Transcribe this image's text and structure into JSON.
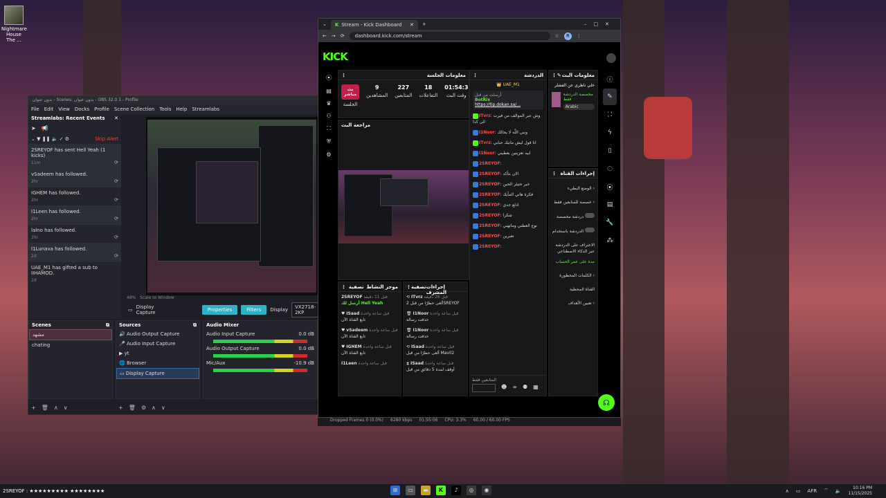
{
  "desktop": {
    "icon_label": "Nightmare House The ..."
  },
  "obs": {
    "title": "بدون عنوان - Scenes: بدون عنوان - OBS 32.0.1 - Profile",
    "menu": [
      "File",
      "Edit",
      "View",
      "Docks",
      "Profile",
      "Scene Collection",
      "Tools",
      "Help",
      "Streamlabs"
    ],
    "events_title": "Streamlabs: Recent Events",
    "skip_alert": "Skip Alert",
    "events": [
      {
        "text": "2SREYOF has sent Hell Yeah (1 kicks)",
        "time": "11m"
      },
      {
        "text": "vSadeem has followed.",
        "time": "2hr"
      },
      {
        "text": "IGHEM has followed.",
        "time": "2hr"
      },
      {
        "text": "I1Leen has followed.",
        "time": "2hr"
      },
      {
        "text": "lalno has followed.",
        "time": "2hr"
      },
      {
        "text": "I1Lunava has followed.",
        "time": "2d"
      },
      {
        "text": "UAE_M1 has gifted a sub to IIHAMOD.",
        "time": "2d"
      }
    ],
    "preview_bar": "Scale to Window",
    "preview_zoom": "48%",
    "context": {
      "source": "Display Capture",
      "properties": "Properties",
      "filters": "Filters",
      "display_label": "Display",
      "display_value": "VX2718-2KP"
    },
    "scenes_title": "Scenes",
    "scenes": [
      "مشهد",
      "chating"
    ],
    "sources_title": "Sources",
    "sources": [
      "Audio Output Capture",
      "Audio Input Capture",
      "yt",
      "Browser",
      "Display Capture"
    ],
    "mixer_title": "Audio Mixer",
    "mixer": [
      {
        "name": "Audio Input Capture",
        "level": "0.0 dB"
      },
      {
        "name": "Audio Output Capture",
        "level": "0.0 dB"
      },
      {
        "name": "Mic/Aux",
        "level": "-10.9 dB"
      }
    ]
  },
  "chrome": {
    "tab_title": "Stream - Kick Dashboard",
    "url": "dashboard.kick.com/stream",
    "avatar_letter": "R"
  },
  "kick": {
    "logo": "KICK",
    "session": {
      "title": "معلومات الجلسة",
      "live_badge": "بث مباشر",
      "live_label": "الجلسة",
      "stats": [
        {
          "value": "9",
          "label": "المشاهدين"
        },
        {
          "value": "227",
          "label": "المتابعين"
        },
        {
          "value": "18",
          "label": "التفاعلات"
        },
        {
          "value": "01:54:3",
          "label": "وقت البث"
        }
      ]
    },
    "preview_title": "مراجعة البث",
    "chat": {
      "title": "الدردشة",
      "pinned_user": "UAE_M1",
      "pinned_by": "BotRix",
      "pinned_sent_by": "أرسلت من قبل",
      "pinned_link": "https://tip.dokan.sa/...",
      "lines": [
        {
          "user": "ITvrz",
          "msg": "وش عبر الموالف من فيرت الى كذا"
        },
        {
          "user": "I1Noor",
          "msg": "ونبي اللّه لا يحالك"
        },
        {
          "user": "ITvrz",
          "msg": "انا قول ليش ماتيك حبابي"
        },
        {
          "user": "I1Noor",
          "msg": "ابيه تعزيتين بعطيني"
        },
        {
          "user": "2SREYOF",
          "msg": ""
        },
        {
          "user": "2SREYOF",
          "msg": "الان بتأكد"
        },
        {
          "user": "2SREYOF",
          "msg": "خير حتيئر الحين"
        },
        {
          "user": "2SREYOF",
          "msg": "فكرة هاتي المأيك"
        },
        {
          "user": "2SREYOF",
          "msg": "اذلع حدي"
        },
        {
          "user": "2SREYOF",
          "msg": "شكرا"
        },
        {
          "user": "2SREYOF",
          "msg": "نوع العطني وماتهني"
        },
        {
          "user": "2SREYOF",
          "msg": "تعبرين"
        },
        {
          "user": "2SREYOF",
          "msg": ""
        }
      ],
      "followers_only": "المتابعين فقط"
    },
    "stream_info": {
      "title": "معلومات البث",
      "headline": "خلي ناظري عن الفشلر",
      "category": "مخصصة الدردشة فقط",
      "language": "Arabic"
    },
    "actions": {
      "title": "إجراءات القناة",
      "items": [
        "الوضع البطيء",
        "خصصة للمتابعين فقط",
        "دردشة مخصصة",
        "الدردشة باستخدام",
        "الاعتراف على الدردشة عبر الذكاء الاصطناعي",
        "مدة على عمر الحساب",
        "الكلمات المحظورة",
        "القناة المحظية",
        "تعيين الأهداف"
      ]
    },
    "mod_actions": {
      "title": "إجراءات المشرف",
      "filter": "تصفية",
      "items": [
        {
          "user": "ITvrz",
          "time": "قبل 26 دقيقة",
          "desc": "ألغى حظرًا من قبل 2SREYOF"
        },
        {
          "user": "I1Noor",
          "time": "قبل ساعة واحدة",
          "desc": "حذفت رسالة"
        },
        {
          "user": "I1Noor",
          "time": "قبل ساعة واحدة",
          "desc": "حذفت رسالة"
        },
        {
          "user": "ISaad",
          "time": "قبل ساعة واحدة",
          "desc": "ألغى حظرًا من قبل Mavil2"
        },
        {
          "user": "ISaad",
          "time": "قبل ساعة واحدة",
          "desc": "أوقف لمدة 5 دقائق من قبل"
        }
      ]
    },
    "activity": {
      "title": "موجز النشاط",
      "filter": "تصفية",
      "items": [
        {
          "user": "2SREYOF",
          "time": "قبل 11 دقيقة",
          "desc": "أرسل لك Hell Yeah"
        },
        {
          "user": "ISaad",
          "time": "قبل ساعة واحدة",
          "desc": "تابع القناة الآن"
        },
        {
          "user": "vSadeem",
          "time": "قبل ساعة واحدة",
          "desc": "تابع القناة الآن"
        },
        {
          "user": "IGHEM",
          "time": "قبل ساعة واحدة",
          "desc": "تابع القناة الآن"
        },
        {
          "user": "I1Leen",
          "time": "قبل ساعة واحدة",
          "desc": ""
        }
      ]
    }
  },
  "obs_status": {
    "dropped": "Dropped Frames 0 (0.0%)",
    "bitrate": "6280 kbps",
    "time": "01:55:06",
    "cpu": "CPU: 3.3%",
    "fps": "60.00 / 60.00 FPS"
  },
  "taskbar": {
    "ticker": "2SREYOF : ★★★★★★★★★ ★★★★★★★★",
    "lang": "AFR",
    "time": "10:16 PM",
    "date": "11/15/2025"
  },
  "colors": {
    "kick_green": "#53fc18",
    "obs_cyan": "#2fb2c6",
    "alert_red": "#e04a4a"
  }
}
